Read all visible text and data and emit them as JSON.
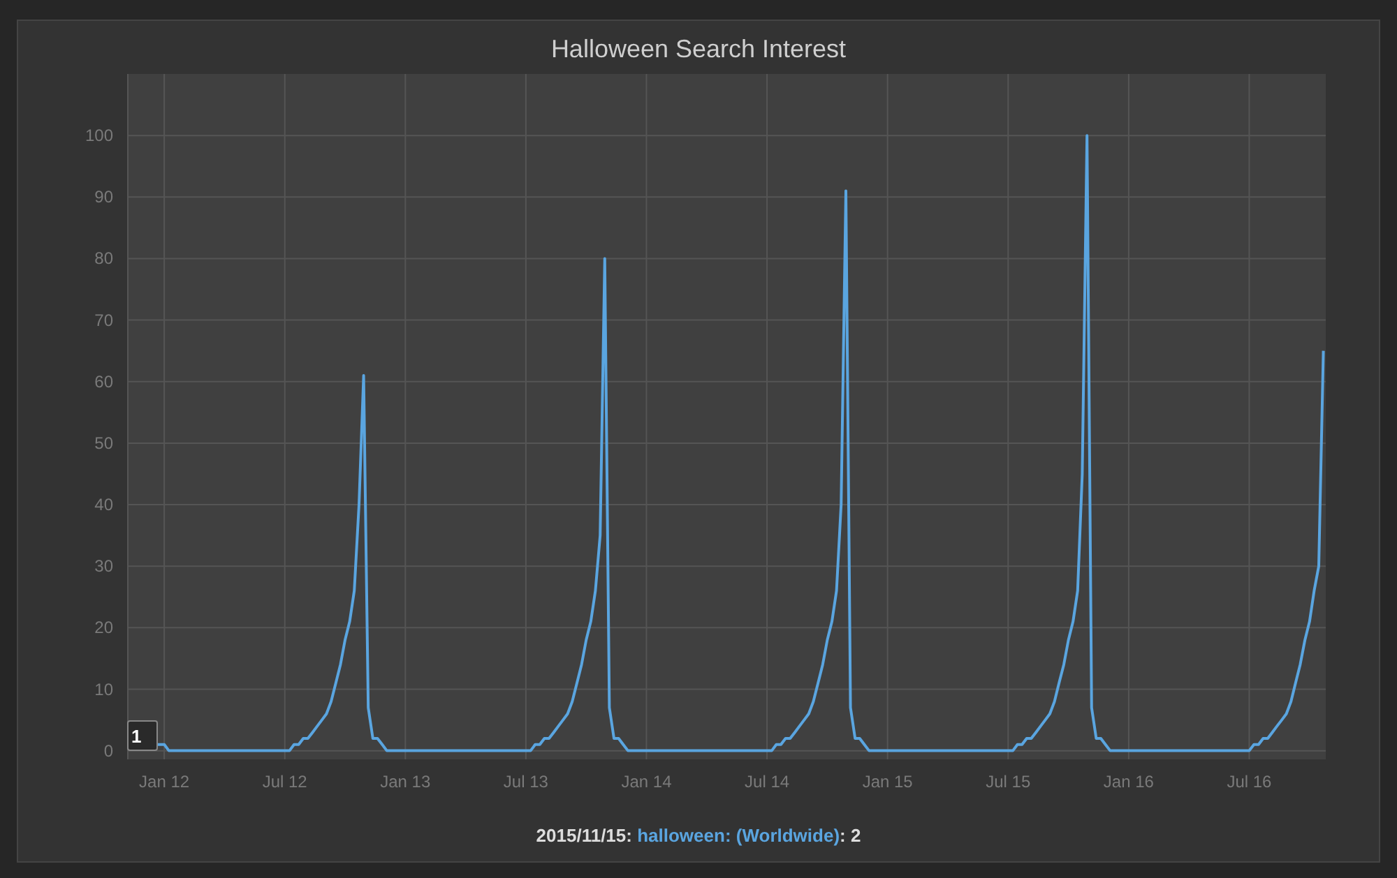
{
  "chart": {
    "title": "Halloween Search Interest",
    "chart_data": {
      "type": "line",
      "grid": true,
      "ylim": [
        -1.4,
        110
      ],
      "yticks": [
        0,
        10,
        20,
        30,
        40,
        50,
        60,
        70,
        80,
        90,
        100
      ],
      "categories": [
        null,
        null,
        null,
        null,
        null,
        null,
        null,
        null,
        "Jan 12",
        null,
        null,
        null,
        null,
        null,
        null,
        null,
        null,
        null,
        null,
        null,
        null,
        null,
        null,
        null,
        null,
        null,
        null,
        null,
        null,
        null,
        null,
        null,
        null,
        null,
        "Jul 12",
        null,
        null,
        null,
        null,
        null,
        null,
        null,
        null,
        null,
        null,
        null,
        null,
        null,
        null,
        null,
        null,
        null,
        null,
        null,
        null,
        null,
        null,
        null,
        null,
        null,
        "Jan 13",
        null,
        null,
        null,
        null,
        null,
        null,
        null,
        null,
        null,
        null,
        null,
        null,
        null,
        null,
        null,
        null,
        null,
        null,
        null,
        null,
        null,
        null,
        null,
        null,
        null,
        "Jul 13",
        null,
        null,
        null,
        null,
        null,
        null,
        null,
        null,
        null,
        null,
        null,
        null,
        null,
        null,
        null,
        null,
        null,
        null,
        null,
        null,
        null,
        null,
        null,
        null,
        null,
        "Jan 14",
        null,
        null,
        null,
        null,
        null,
        null,
        null,
        null,
        null,
        null,
        null,
        null,
        null,
        null,
        null,
        null,
        null,
        null,
        null,
        null,
        null,
        null,
        null,
        null,
        null,
        "Jul 14",
        null,
        null,
        null,
        null,
        null,
        null,
        null,
        null,
        null,
        null,
        null,
        null,
        null,
        null,
        null,
        null,
        null,
        null,
        null,
        null,
        null,
        null,
        null,
        null,
        null,
        "Jan 15",
        null,
        null,
        null,
        null,
        null,
        null,
        null,
        null,
        null,
        null,
        null,
        null,
        null,
        null,
        null,
        null,
        null,
        null,
        null,
        null,
        null,
        null,
        null,
        null,
        null,
        "Jul 15",
        null,
        null,
        null,
        null,
        null,
        null,
        null,
        null,
        null,
        null,
        null,
        null,
        null,
        null,
        null,
        null,
        null,
        null,
        null,
        null,
        null,
        null,
        null,
        null,
        null,
        "Jan 16",
        null,
        null,
        null,
        null,
        null,
        null,
        null,
        null,
        null,
        null,
        null,
        null,
        null,
        null,
        null,
        null,
        null,
        null,
        null,
        null,
        null,
        null,
        null,
        null,
        null,
        "Jul 16",
        null,
        null,
        null,
        null,
        null,
        null,
        null,
        null,
        null,
        null,
        null,
        null,
        null,
        null,
        null,
        null
      ],
      "series": [
        {
          "name": "halloween: (Worldwide)",
          "color": "#5aa5e0",
          "values": [
            null,
            null,
            null,
            null,
            null,
            null,
            1,
            1,
            1,
            0,
            0,
            0,
            0,
            0,
            0,
            0,
            0,
            0,
            0,
            0,
            0,
            0,
            0,
            0,
            0,
            0,
            0,
            0,
            0,
            0,
            0,
            0,
            0,
            0,
            0,
            0,
            1,
            1,
            2,
            2,
            3,
            4,
            5,
            6,
            8,
            11,
            14,
            18,
            21,
            26,
            40,
            61,
            7,
            2,
            2,
            1,
            0,
            0,
            0,
            0,
            0,
            0,
            0,
            0,
            0,
            0,
            0,
            0,
            0,
            0,
            0,
            0,
            0,
            0,
            0,
            0,
            0,
            0,
            0,
            0,
            0,
            0,
            0,
            0,
            0,
            0,
            0,
            0,
            1,
            1,
            2,
            2,
            3,
            4,
            5,
            6,
            8,
            11,
            14,
            18,
            21,
            26,
            35,
            80,
            7,
            2,
            2,
            1,
            0,
            0,
            0,
            0,
            0,
            0,
            0,
            0,
            0,
            0,
            0,
            0,
            0,
            0,
            0,
            0,
            0,
            0,
            0,
            0,
            0,
            0,
            0,
            0,
            0,
            0,
            0,
            0,
            0,
            0,
            0,
            0,
            1,
            1,
            2,
            2,
            3,
            4,
            5,
            6,
            8,
            11,
            14,
            18,
            21,
            26,
            40,
            91,
            7,
            2,
            2,
            1,
            0,
            0,
            0,
            0,
            0,
            0,
            0,
            0,
            0,
            0,
            0,
            0,
            0,
            0,
            0,
            0,
            0,
            0,
            0,
            0,
            0,
            0,
            0,
            0,
            0,
            0,
            0,
            0,
            0,
            0,
            0,
            0,
            1,
            1,
            2,
            2,
            3,
            4,
            5,
            6,
            8,
            11,
            14,
            18,
            21,
            26,
            45,
            100,
            7,
            2,
            2,
            1,
            0,
            0,
            0,
            0,
            0,
            0,
            0,
            0,
            0,
            0,
            0,
            0,
            0,
            0,
            0,
            0,
            0,
            0,
            0,
            0,
            0,
            0,
            0,
            0,
            0,
            0,
            0,
            0,
            0,
            0,
            0,
            1,
            1,
            2,
            2,
            3,
            4,
            5,
            6,
            8,
            11,
            14,
            18,
            21,
            26,
            30,
            65
          ]
        }
      ]
    },
    "corner_tag": "1",
    "legend": {
      "prefix": "2015/11/15:",
      "suffix": ": 2"
    }
  }
}
